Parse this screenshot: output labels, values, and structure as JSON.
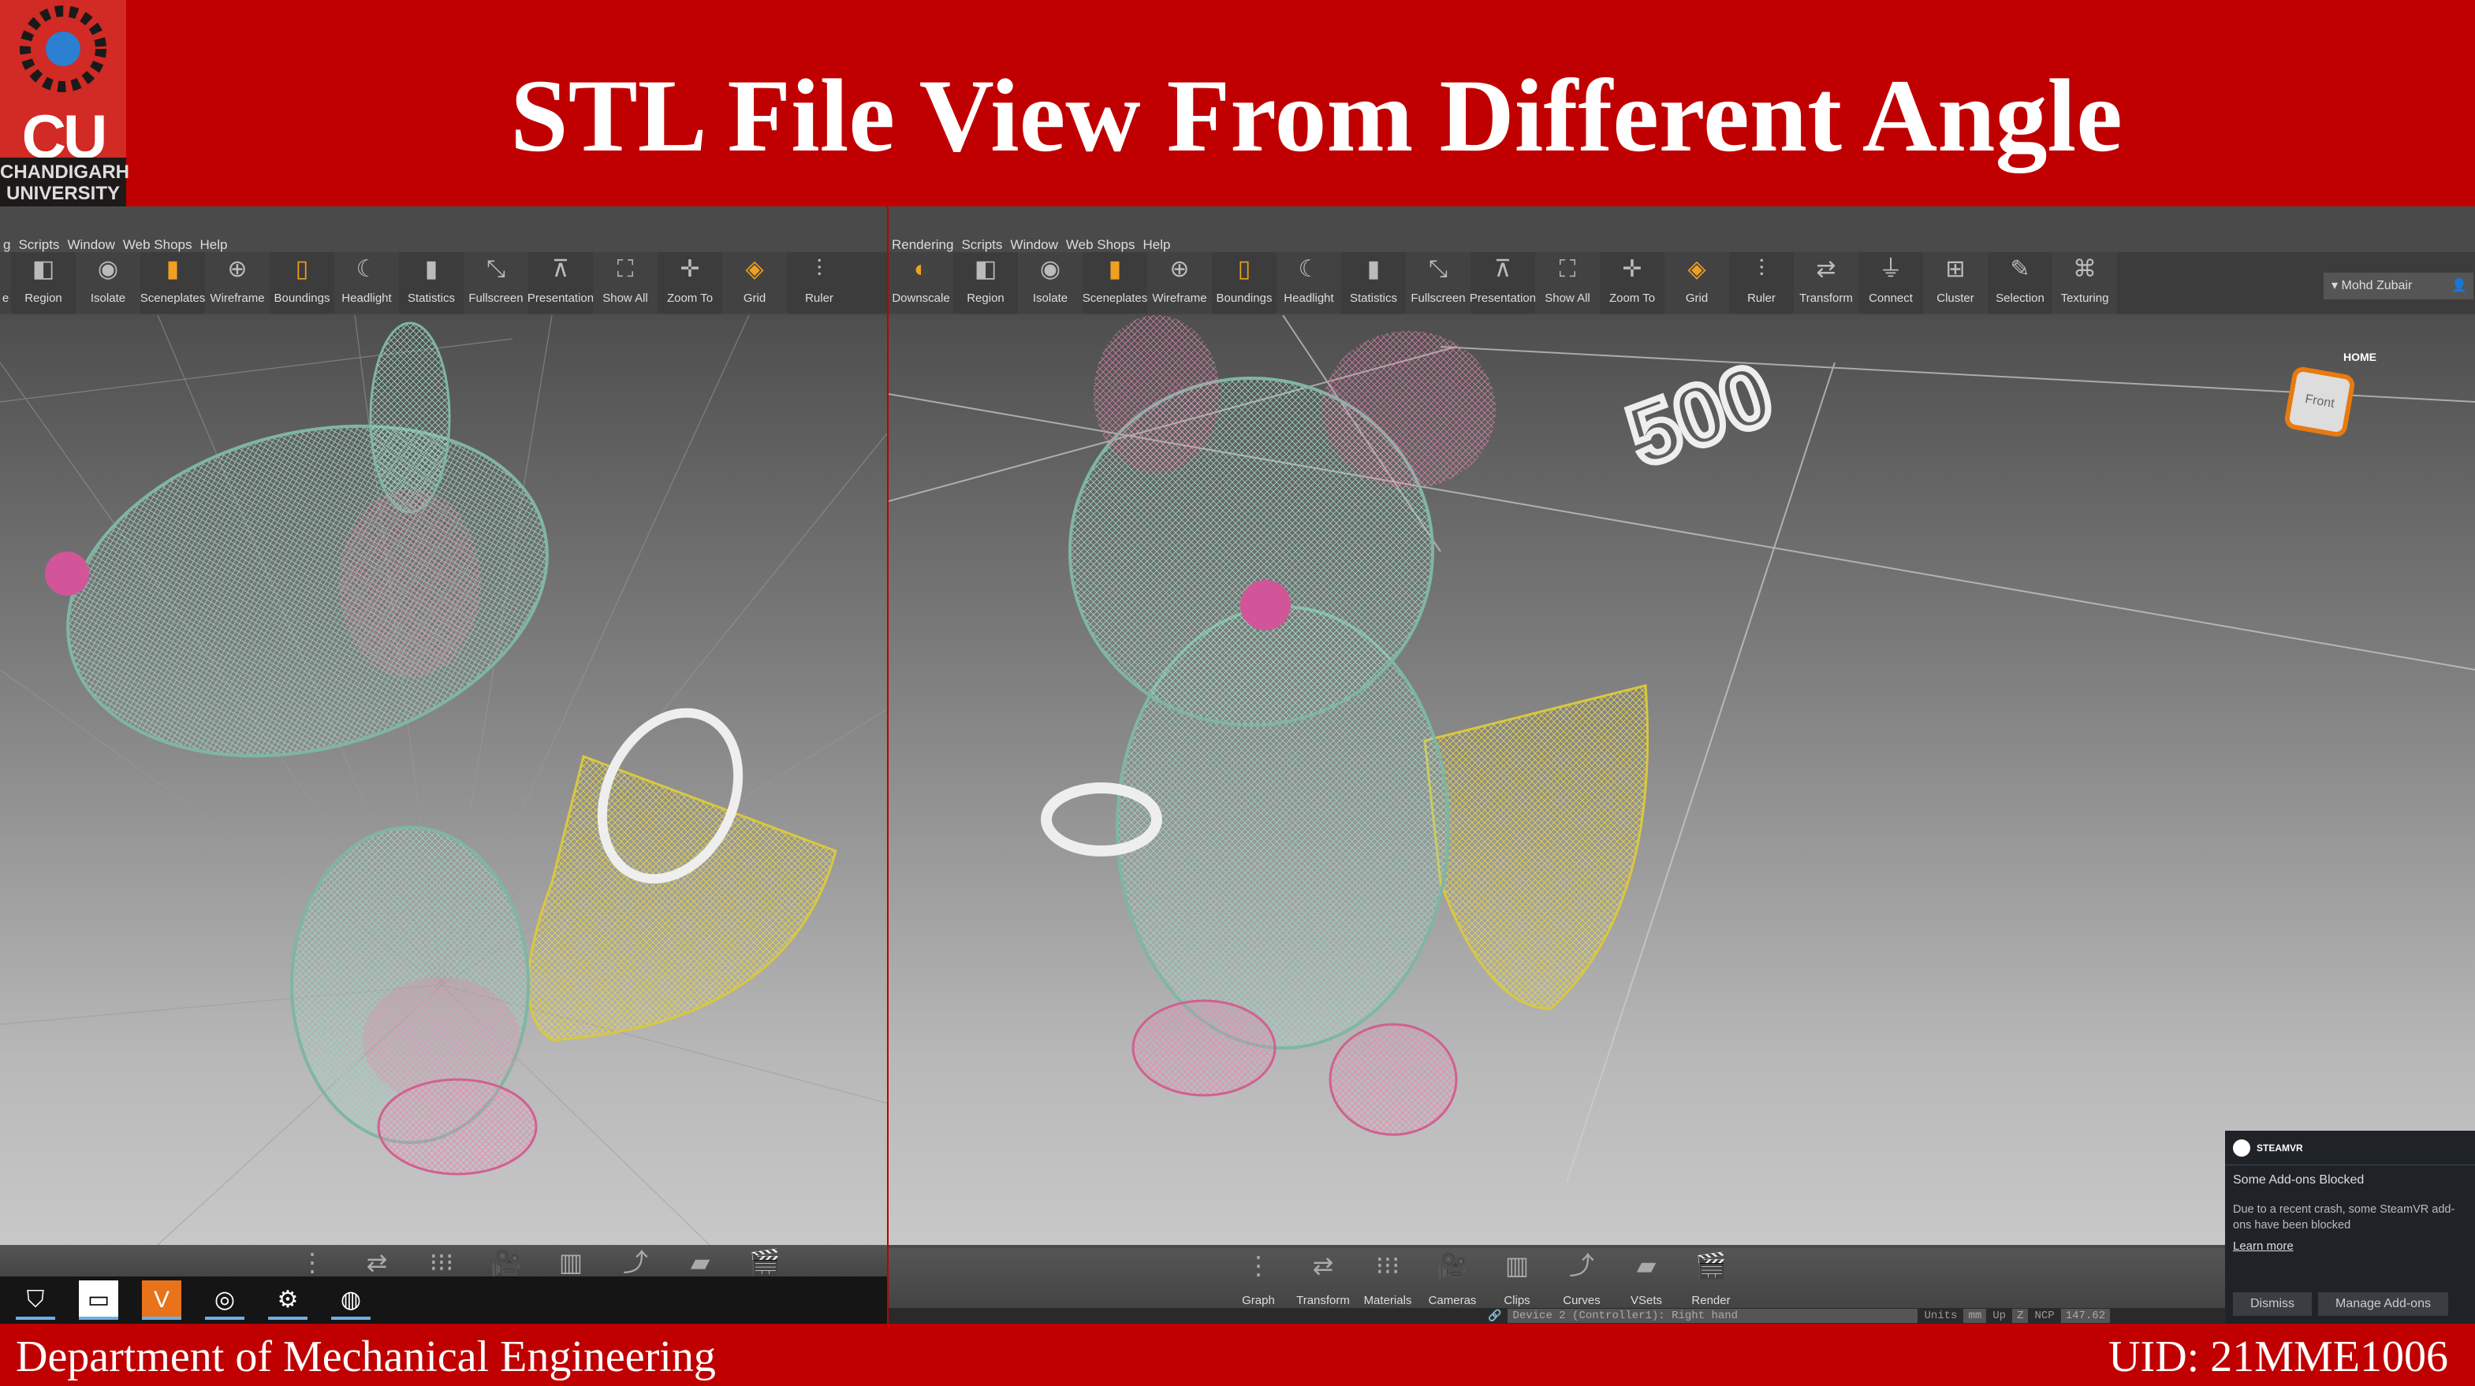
{
  "header": {
    "title": "STL File View From Different Angle",
    "logo": {
      "initials": "CU",
      "name_line1": "CHANDIGARH",
      "name_line2": "UNIVERSITY"
    }
  },
  "left": {
    "menu": [
      "g",
      "Scripts",
      "Window",
      "Web Shops",
      "Help"
    ],
    "toolbar": [
      {
        "label": "e",
        "icon": "partial"
      },
      {
        "label": "Region",
        "icon": "region-icon"
      },
      {
        "label": "Isolate",
        "icon": "eye-icon"
      },
      {
        "label": "Sceneplates",
        "icon": "sceneplates-icon"
      },
      {
        "label": "Wireframe",
        "icon": "globe-icon"
      },
      {
        "label": "Boundings",
        "icon": "box-icon"
      },
      {
        "label": "Headlight",
        "icon": "headlight-icon"
      },
      {
        "label": "Statistics",
        "icon": "bar-chart-icon"
      },
      {
        "label": "Fullscreen",
        "icon": "arrows-icon"
      },
      {
        "label": "Presentation",
        "icon": "easel-icon"
      },
      {
        "label": "Show All",
        "icon": "expand-icon"
      },
      {
        "label": "Zoom To",
        "icon": "zoom-to-icon"
      },
      {
        "label": "Grid",
        "icon": "grid-icon"
      },
      {
        "label": "Ruler",
        "icon": "ruler-icon"
      }
    ],
    "viewport_text": "0",
    "taskbar": [
      "shield",
      "oculus",
      "vred-pro",
      "steamvr",
      "settings",
      "obs"
    ]
  },
  "right": {
    "menu": [
      "Rendering",
      "Scripts",
      "Window",
      "Web Shops",
      "Help"
    ],
    "toolbar": [
      {
        "label": "Downscale"
      },
      {
        "label": "Region"
      },
      {
        "label": "Isolate"
      },
      {
        "label": "Sceneplates"
      },
      {
        "label": "Wireframe"
      },
      {
        "label": "Boundings"
      },
      {
        "label": "Headlight"
      },
      {
        "label": "Statistics"
      },
      {
        "label": "Fullscreen"
      },
      {
        "label": "Presentation"
      },
      {
        "label": "Show All"
      },
      {
        "label": "Zoom To"
      },
      {
        "label": "Grid"
      },
      {
        "label": "Ruler"
      },
      {
        "label": "Transform"
      },
      {
        "label": "Connect"
      },
      {
        "label": "Cluster"
      },
      {
        "label": "Selection"
      },
      {
        "label": "Texturing"
      }
    ],
    "user": "Mohd Zubair",
    "viewport_text": "500",
    "viewcube": {
      "home": "HOME",
      "face": "Front"
    },
    "dock": [
      "Graph",
      "Transform",
      "Materials",
      "Cameras",
      "Clips",
      "Curves",
      "VSets",
      "Render"
    ],
    "status": {
      "console": "Device 2 (Controller1): Right hand",
      "units_label": "Units",
      "units": "mm",
      "up_label": "Up",
      "up": "Z",
      "ncp_label": "NCP",
      "ncp": "147.62"
    }
  },
  "steamvr": {
    "brand": "STEAMVR",
    "title": "Some Add-ons Blocked",
    "body": "Due to a recent crash, some SteamVR add-ons have been blocked",
    "link": "Learn more",
    "dismiss": "Dismiss",
    "manage": "Manage Add-ons"
  },
  "footer": {
    "department": "Department of Mechanical Engineering",
    "uid": "UID: 21MME1006"
  }
}
